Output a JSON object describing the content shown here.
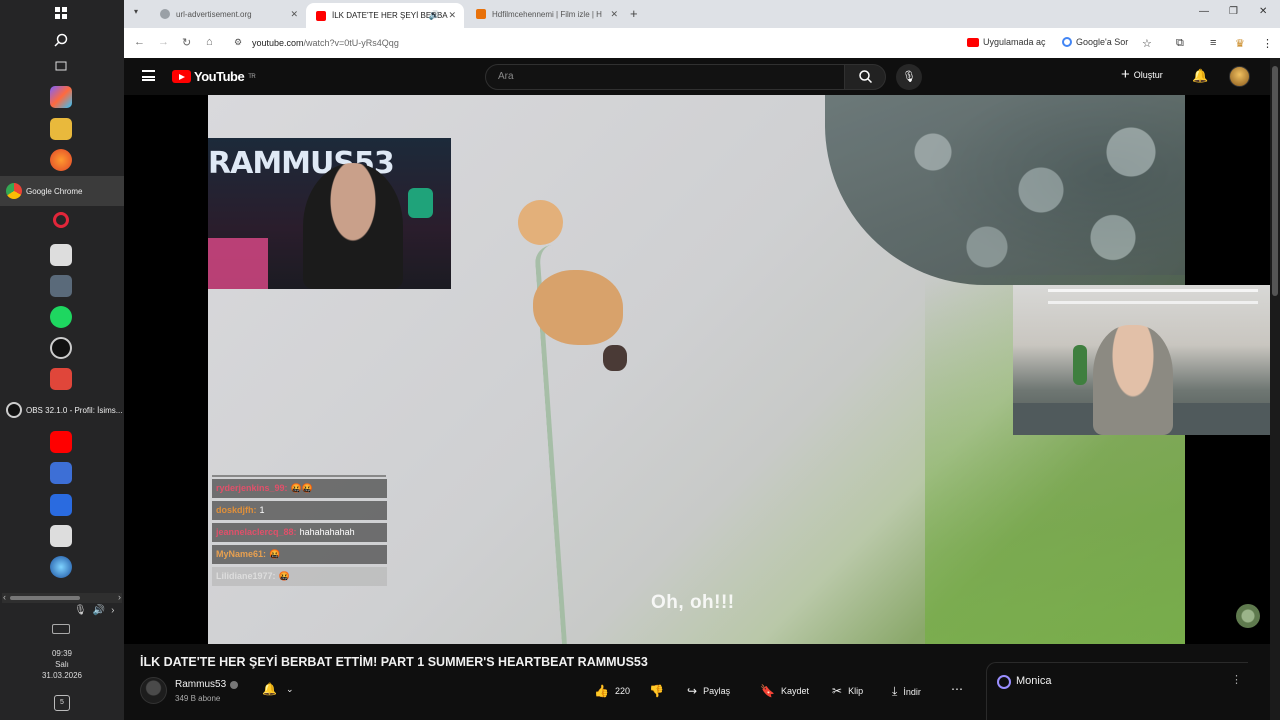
{
  "taskbar": {
    "chrome_label": "Google Chrome",
    "obs_label": "OBS 32.1.0 - Profil: İsims...",
    "clock_time": "09:39",
    "clock_day": "Salı",
    "clock_date": "31.03.2026",
    "notif_count": "5"
  },
  "browser": {
    "tabs": [
      {
        "title": "url-advertisement.org"
      },
      {
        "title": "İLK DATE'TE HER ŞEYİ BERBA"
      },
      {
        "title": "Hdfilmcehennemi | Film izle | H"
      }
    ],
    "url_host": "youtube.com",
    "url_path": "/watch?v=0tU-yRs4Qqg",
    "open_in_app": "Uygulamada aç",
    "ask_google": "Google'a Sor"
  },
  "youtube": {
    "logo_text": "YouTube",
    "logo_sup": "TR",
    "search_placeholder": "Ara",
    "create_label": "Oluştur"
  },
  "overlay": {
    "banner": "RAMMUS53",
    "subtitle": "Oh, oh!!!",
    "chat": [
      {
        "user": "ryderjenkins_99:",
        "msg": "🤬🤬",
        "color": "#e0506a"
      },
      {
        "user": "doskdjfh:",
        "msg": "1",
        "color": "#e0903a"
      },
      {
        "user": "jeannelaclercq_88:",
        "msg": "hahahahahah",
        "color": "#e0506a"
      },
      {
        "user": "MyName61:",
        "msg": "🤬",
        "color": "#e8a050"
      },
      {
        "user": "Lilidiane1977:",
        "msg": "🤬",
        "color": "#dddddd"
      }
    ]
  },
  "video": {
    "title": "İLK DATE'TE HER ŞEYİ BERBAT ETTİM! PART 1 SUMMER'S HEARTBEAT RAMMUS53",
    "channel": "Rammus53",
    "subscribers": "349 B abone",
    "likes": "220",
    "share": "Paylaş",
    "save": "Kaydet",
    "clip": "Klip",
    "download": "İndir"
  },
  "sidepanel": {
    "label": "Monica"
  }
}
